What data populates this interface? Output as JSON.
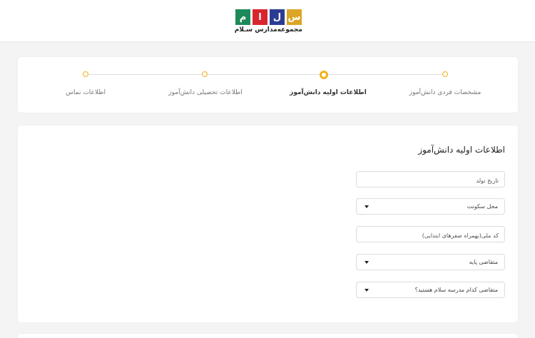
{
  "header": {
    "logo_letters": [
      "م",
      "ا",
      "ل",
      "س"
    ],
    "logo_subtitle": "مجموعه‌مدارس سـلام",
    "colors": {
      "green": "#1e8a5a",
      "red": "#d8262e",
      "blue": "#2b3c94",
      "yellow": "#dba526"
    }
  },
  "stepper": {
    "steps": [
      {
        "label": "مشخصات فردی دانش‌آموز",
        "state": "pending"
      },
      {
        "label": "اطلاعات اولیه دانش‌آموز",
        "state": "active"
      },
      {
        "label": "اطلاعات تحصیلی دانش‌آموز",
        "state": "pending"
      },
      {
        "label": "اطلاعات تماس",
        "state": "pending"
      }
    ],
    "accent_color": "#f2b21b"
  },
  "form": {
    "title": "اطلاعات اولیه دانش‌آموز",
    "birth_date_placeholder": "تاریخ تولد",
    "residence_label": "محل سکونت",
    "national_code_placeholder": "کد ملی(بهمراه صفرهای ابتدایی)",
    "grade_label": "متقاضی پایه",
    "school_label": "متقاضی کدام مدرسه سلام هستید؟"
  }
}
